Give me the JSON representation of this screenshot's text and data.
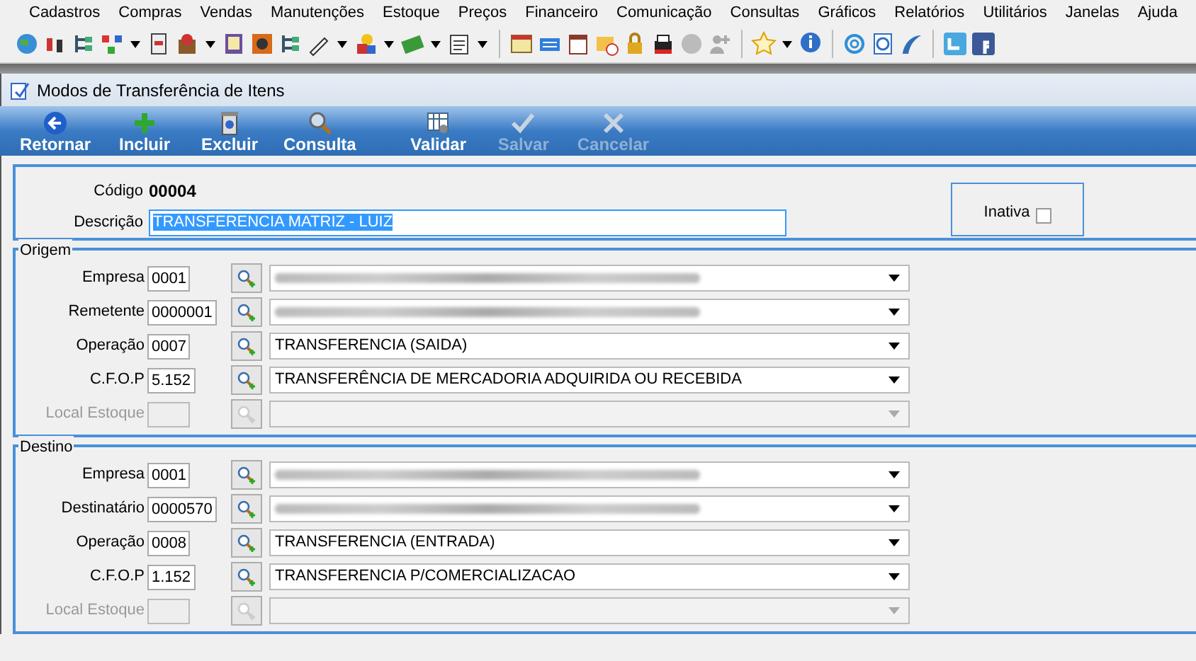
{
  "menu": [
    "Cadastros",
    "Compras",
    "Vendas",
    "Manutenções",
    "Estoque",
    "Preços",
    "Financeiro",
    "Comunicação",
    "Consultas",
    "Gráficos",
    "Relatórios",
    "Utilitários",
    "Janelas",
    "Ajuda"
  ],
  "toolbar": [
    {
      "has_menu": false
    },
    {
      "has_menu": false
    },
    {
      "has_menu": false
    },
    {
      "has_menu": true
    },
    {
      "has_menu": false
    },
    {
      "has_menu": true
    },
    {
      "has_menu": false
    },
    {
      "has_menu": false
    },
    {
      "has_menu": false
    },
    {
      "has_menu": true
    },
    {
      "has_menu": true
    },
    {
      "has_menu": true
    },
    {
      "has_menu": true
    },
    {
      "has_menu": false
    },
    {
      "has_menu": false
    },
    {
      "has_menu": false
    },
    {
      "has_menu": false
    },
    {
      "has_menu": false
    },
    {
      "has_menu": false
    },
    {
      "has_menu": false
    },
    {
      "has_menu": false
    },
    {
      "has_menu": true
    },
    {
      "has_menu": false
    },
    {
      "has_menu": false
    },
    {
      "has_menu": false
    },
    {
      "has_menu": false
    },
    {
      "has_menu": false
    },
    {
      "has_menu": false
    }
  ],
  "window": {
    "title": "Modos de Transferência de Itens"
  },
  "actions": [
    {
      "label": "Retornar",
      "disabled": false
    },
    {
      "label": "Incluir",
      "disabled": false
    },
    {
      "label": "Excluir",
      "disabled": false
    },
    {
      "label": "Consulta",
      "disabled": false
    },
    {
      "label": "Validar",
      "disabled": false
    },
    {
      "label": "Salvar",
      "disabled": true
    },
    {
      "label": "Cancelar",
      "disabled": true
    }
  ],
  "header": {
    "code_label": "Código",
    "code": "00004",
    "description_label": "Descrição",
    "description": "TRANSFERENCIA MATRIZ - LUIZ",
    "inactive_label": "Inativa",
    "inactive": false
  },
  "sections": [
    {
      "title": "Origem",
      "rows": [
        {
          "label": "Empresa",
          "code": "0001",
          "redacted": true,
          "disabled": false
        },
        {
          "label": "Remetente",
          "code": "0000001",
          "redacted": true,
          "disabled": false
        },
        {
          "label": "Operação",
          "code": "0007",
          "description": "TRANSFERENCIA (SAIDA)",
          "redacted": false,
          "disabled": false
        },
        {
          "label": "C.F.O.P",
          "code": "5.152",
          "description": "TRANSFERÊNCIA DE MERCADORIA ADQUIRIDA OU RECEBIDA",
          "redacted": false,
          "disabled": false
        },
        {
          "label": "Local Estoque",
          "redacted": false,
          "disabled": true
        }
      ]
    },
    {
      "title": "Destino",
      "rows": [
        {
          "label": "Empresa",
          "code": "0001",
          "redacted": true,
          "disabled": false
        },
        {
          "label": "Destinatário",
          "code": "0000570",
          "redacted": true,
          "disabled": false
        },
        {
          "label": "Operação",
          "code": "0008",
          "description": "TRANSFERENCIA (ENTRADA)",
          "redacted": false,
          "disabled": false
        },
        {
          "label": "C.F.O.P",
          "code": "1.152",
          "description": "TRANSFERENCIA P/COMERCIALIZACAO",
          "redacted": false,
          "disabled": false
        },
        {
          "label": "Local Estoque",
          "redacted": false,
          "disabled": true
        }
      ]
    }
  ]
}
